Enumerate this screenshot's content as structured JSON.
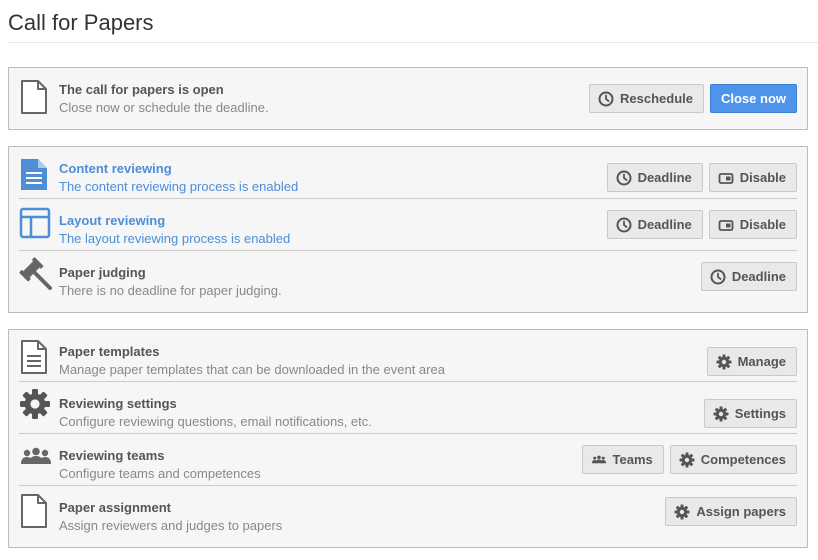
{
  "page": {
    "title": "Call for Papers"
  },
  "cfp": {
    "title": "The call for papers is open",
    "description": "Close now or schedule the deadline.",
    "reschedule_label": "Reschedule",
    "close_label": "Close now"
  },
  "reviewing": {
    "content": {
      "title": "Content reviewing",
      "description": "The content reviewing process is enabled",
      "deadline_label": "Deadline",
      "disable_label": "Disable"
    },
    "layout": {
      "title": "Layout reviewing",
      "description": "The layout reviewing process is enabled",
      "deadline_label": "Deadline",
      "disable_label": "Disable"
    },
    "judging": {
      "title": "Paper judging",
      "description": "There is no deadline for paper judging.",
      "deadline_label": "Deadline"
    }
  },
  "settings": {
    "templates": {
      "title": "Paper templates",
      "description": "Manage paper templates that can be downloaded in the event area",
      "manage_label": "Manage"
    },
    "reviewing_settings": {
      "title": "Reviewing settings",
      "description": "Configure reviewing questions, email notifications, etc.",
      "settings_label": "Settings"
    },
    "teams": {
      "title": "Reviewing teams",
      "description": "Configure teams and competences",
      "teams_label": "Teams",
      "competences_label": "Competences"
    },
    "assignment": {
      "title": "Paper assignment",
      "description": "Assign reviewers and judges to papers",
      "assign_label": "Assign papers"
    }
  },
  "colors": {
    "accent_blue": "#4d8ed6",
    "primary_button": "#4d94ea",
    "panel_bg": "#f6f6f6",
    "icon_gray": "#666666"
  }
}
